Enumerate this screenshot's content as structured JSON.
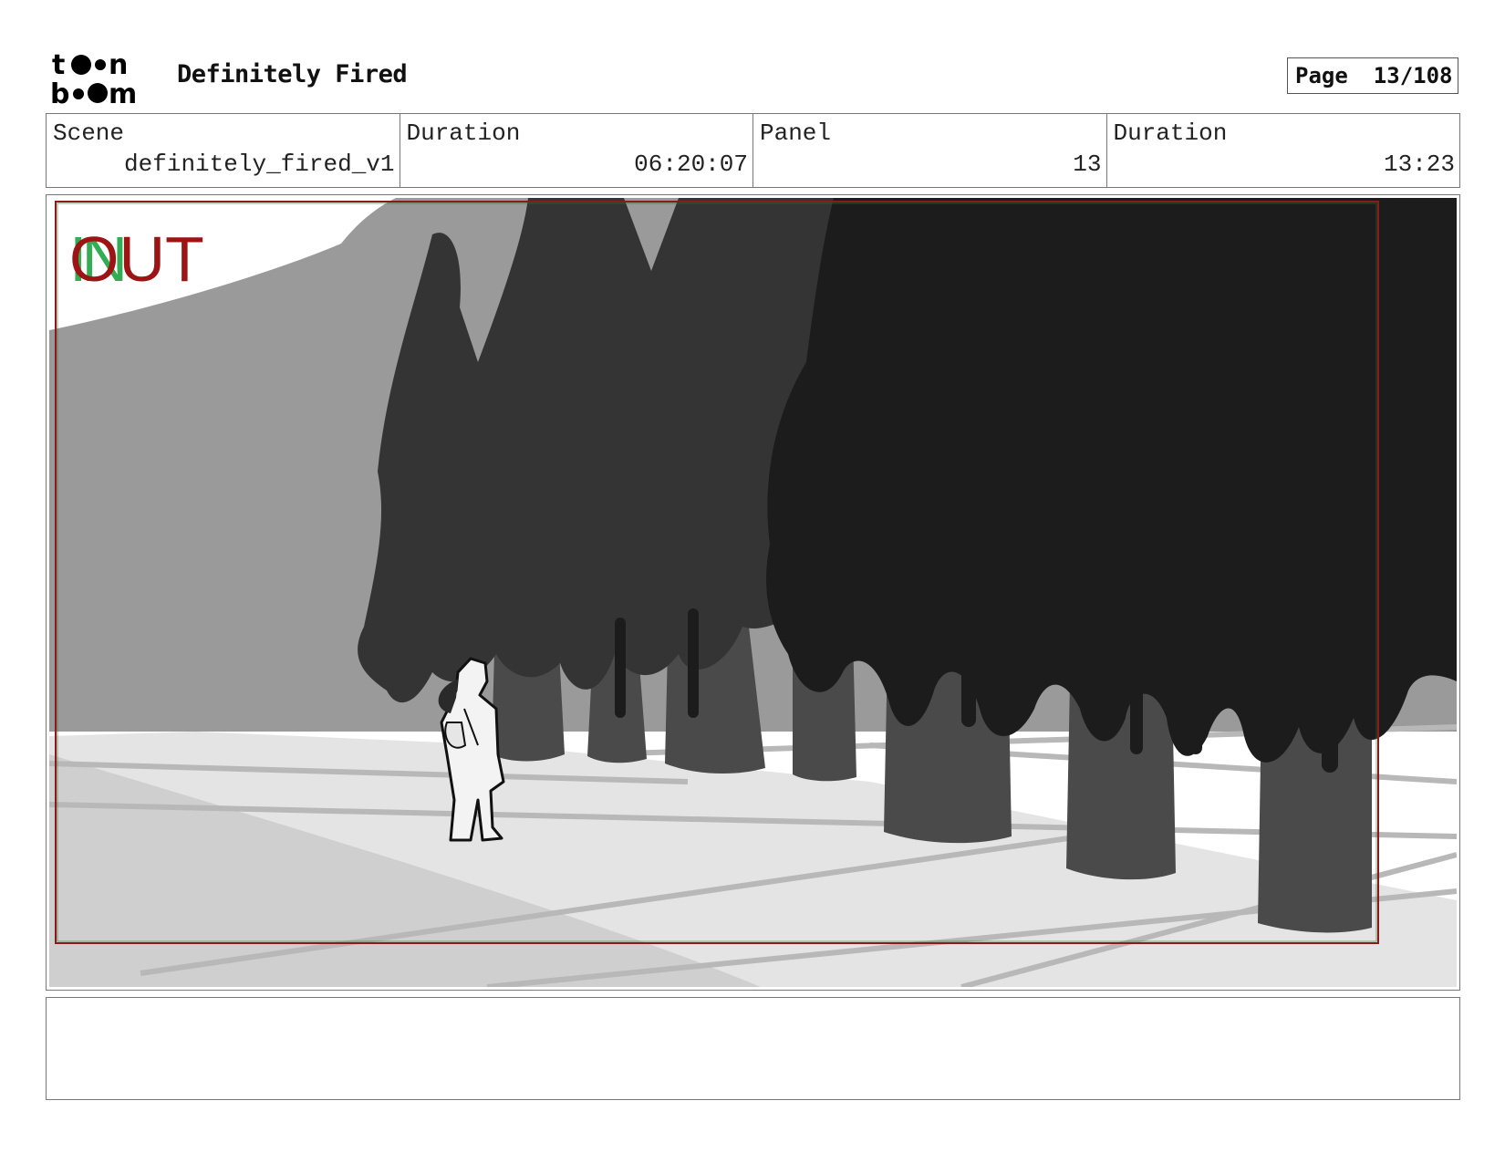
{
  "header": {
    "logo_text": "toon boom",
    "project_title": "Definitely Fired",
    "page_label": "Page",
    "page_value": "13/108"
  },
  "info": {
    "scene_label": "Scene",
    "scene_value": "definitely_fired_v1",
    "scene_duration_label": "Duration",
    "scene_duration_value": "06:20:07",
    "panel_label": "Panel",
    "panel_value": "13",
    "panel_duration_label": "Duration",
    "panel_duration_value": "13:23"
  },
  "panel": {
    "overlay_in": "IN",
    "overlay_out": "OUT",
    "colors": {
      "safe_frame": "#8b1a1a",
      "in_marker": "#2aa84a",
      "out_marker": "#9c1414"
    }
  },
  "notes": {
    "text": ""
  }
}
